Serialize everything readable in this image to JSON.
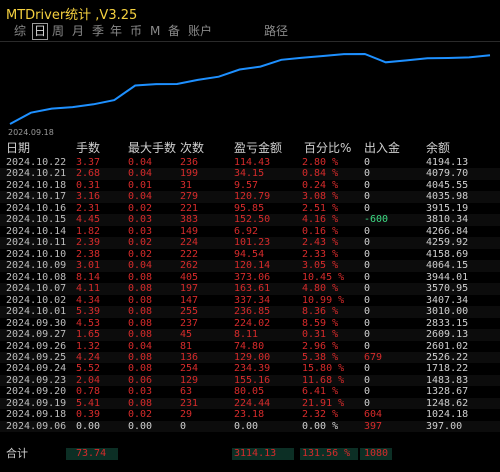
{
  "app": {
    "title": "MTDriver统计 ,V3.25"
  },
  "tabs": [
    {
      "label": "综",
      "active": false
    },
    {
      "label": "日",
      "active": true
    },
    {
      "label": "周",
      "active": false
    },
    {
      "label": "月",
      "active": false
    },
    {
      "label": "季",
      "active": false
    },
    {
      "label": "年",
      "active": false
    },
    {
      "label": "币",
      "active": false
    },
    {
      "label": "M",
      "active": false
    },
    {
      "label": "备",
      "active": false
    },
    {
      "label": "账户",
      "active": false
    },
    {
      "label": "路径",
      "active": false
    }
  ],
  "chart": {
    "start_label": "2024.09.18",
    "line_color": "#1e90ff",
    "balances_asc": [
      397.0,
      1024.18,
      1248.62,
      1328.67,
      1483.83,
      1718.22,
      2526.22,
      2601.02,
      2609.13,
      2833.15,
      3010.0,
      3407.34,
      3570.95,
      3944.01,
      4064.15,
      4158.69,
      4259.92,
      4266.84,
      3810.34,
      3915.19,
      4035.98,
      4045.55,
      4079.7,
      4194.13
    ]
  },
  "table": {
    "headers": {
      "date": "日期",
      "lots": "手数",
      "maxlots": "最大手数",
      "count": "次数",
      "profit": "盈亏金额",
      "pct": "百分比%",
      "inout": "出入金",
      "balance": "余额"
    },
    "rows": [
      {
        "date": "2024.10.22",
        "lots": "3.37",
        "maxlots": "0.04",
        "count": "236",
        "profit": "114.43",
        "pct": "2.80 %",
        "inout": "0",
        "balance": "4194.13"
      },
      {
        "date": "2024.10.21",
        "lots": "2.68",
        "maxlots": "0.04",
        "count": "199",
        "profit": "34.15",
        "pct": "0.84 %",
        "inout": "0",
        "balance": "4079.70"
      },
      {
        "date": "2024.10.18",
        "lots": "0.31",
        "maxlots": "0.01",
        "count": "31",
        "profit": "9.57",
        "pct": "0.24 %",
        "inout": "0",
        "balance": "4045.55"
      },
      {
        "date": "2024.10.17",
        "lots": "3.16",
        "maxlots": "0.04",
        "count": "279",
        "profit": "120.79",
        "pct": "3.08 %",
        "inout": "0",
        "balance": "4035.98"
      },
      {
        "date": "2024.10.16",
        "lots": "2.31",
        "maxlots": "0.02",
        "count": "221",
        "profit": "95.85",
        "pct": "2.51 %",
        "inout": "0",
        "balance": "3915.19"
      },
      {
        "date": "2024.10.15",
        "lots": "4.45",
        "maxlots": "0.03",
        "count": "383",
        "profit": "152.50",
        "pct": "4.16 %",
        "inout": "-600",
        "balance": "3810.34"
      },
      {
        "date": "2024.10.14",
        "lots": "1.82",
        "maxlots": "0.03",
        "count": "149",
        "profit": "6.92",
        "pct": "0.16 %",
        "inout": "0",
        "balance": "4266.84"
      },
      {
        "date": "2024.10.11",
        "lots": "2.39",
        "maxlots": "0.02",
        "count": "224",
        "profit": "101.23",
        "pct": "2.43 %",
        "inout": "0",
        "balance": "4259.92"
      },
      {
        "date": "2024.10.10",
        "lots": "2.38",
        "maxlots": "0.02",
        "count": "222",
        "profit": "94.54",
        "pct": "2.33 %",
        "inout": "0",
        "balance": "4158.69"
      },
      {
        "date": "2024.10.09",
        "lots": "3.01",
        "maxlots": "0.04",
        "count": "262",
        "profit": "120.14",
        "pct": "3.05 %",
        "inout": "0",
        "balance": "4064.15"
      },
      {
        "date": "2024.10.08",
        "lots": "8.14",
        "maxlots": "0.08",
        "count": "405",
        "profit": "373.06",
        "pct": "10.45 %",
        "inout": "0",
        "balance": "3944.01"
      },
      {
        "date": "2024.10.07",
        "lots": "4.11",
        "maxlots": "0.08",
        "count": "197",
        "profit": "163.61",
        "pct": "4.80 %",
        "inout": "0",
        "balance": "3570.95"
      },
      {
        "date": "2024.10.02",
        "lots": "4.34",
        "maxlots": "0.08",
        "count": "147",
        "profit": "337.34",
        "pct": "10.99 %",
        "inout": "0",
        "balance": "3407.34"
      },
      {
        "date": "2024.10.01",
        "lots": "5.39",
        "maxlots": "0.08",
        "count": "255",
        "profit": "236.85",
        "pct": "8.36 %",
        "inout": "0",
        "balance": "3010.00"
      },
      {
        "date": "2024.09.30",
        "lots": "4.53",
        "maxlots": "0.08",
        "count": "237",
        "profit": "224.02",
        "pct": "8.59 %",
        "inout": "0",
        "balance": "2833.15"
      },
      {
        "date": "2024.09.27",
        "lots": "1.65",
        "maxlots": "0.08",
        "count": "45",
        "profit": "8.11",
        "pct": "0.31 %",
        "inout": "0",
        "balance": "2609.13"
      },
      {
        "date": "2024.09.26",
        "lots": "1.32",
        "maxlots": "0.04",
        "count": "81",
        "profit": "74.80",
        "pct": "2.96 %",
        "inout": "0",
        "balance": "2601.02"
      },
      {
        "date": "2024.09.25",
        "lots": "4.24",
        "maxlots": "0.08",
        "count": "136",
        "profit": "129.00",
        "pct": "5.38 %",
        "inout": "679",
        "balance": "2526.22"
      },
      {
        "date": "2024.09.24",
        "lots": "5.52",
        "maxlots": "0.08",
        "count": "254",
        "profit": "234.39",
        "pct": "15.80 %",
        "inout": "0",
        "balance": "1718.22"
      },
      {
        "date": "2024.09.23",
        "lots": "2.04",
        "maxlots": "0.06",
        "count": "129",
        "profit": "155.16",
        "pct": "11.68 %",
        "inout": "0",
        "balance": "1483.83"
      },
      {
        "date": "2024.09.20",
        "lots": "0.78",
        "maxlots": "0.03",
        "count": "63",
        "profit": "80.05",
        "pct": "6.41 %",
        "inout": "0",
        "balance": "1328.67"
      },
      {
        "date": "2024.09.19",
        "lots": "5.41",
        "maxlots": "0.08",
        "count": "231",
        "profit": "224.44",
        "pct": "21.91 %",
        "inout": "0",
        "balance": "1248.62"
      },
      {
        "date": "2024.09.18",
        "lots": "0.39",
        "maxlots": "0.02",
        "count": "29",
        "profit": "23.18",
        "pct": "2.32 %",
        "inout": "604",
        "balance": "1024.18"
      },
      {
        "date": "2024.09.06",
        "lots": "0.00",
        "maxlots": "0.00",
        "count": "0",
        "profit": "0.00",
        "pct": "0.00 %",
        "inout": "397",
        "balance": "397.00"
      }
    ],
    "total": {
      "label": "合计",
      "lots": "73.74",
      "profit": "3114.13",
      "pct": "131.56 %",
      "inout": "1080"
    }
  },
  "colors": {
    "negative": "#d62b2b",
    "positive_deposit": "#3ddc84",
    "title": "#f4d03f"
  }
}
